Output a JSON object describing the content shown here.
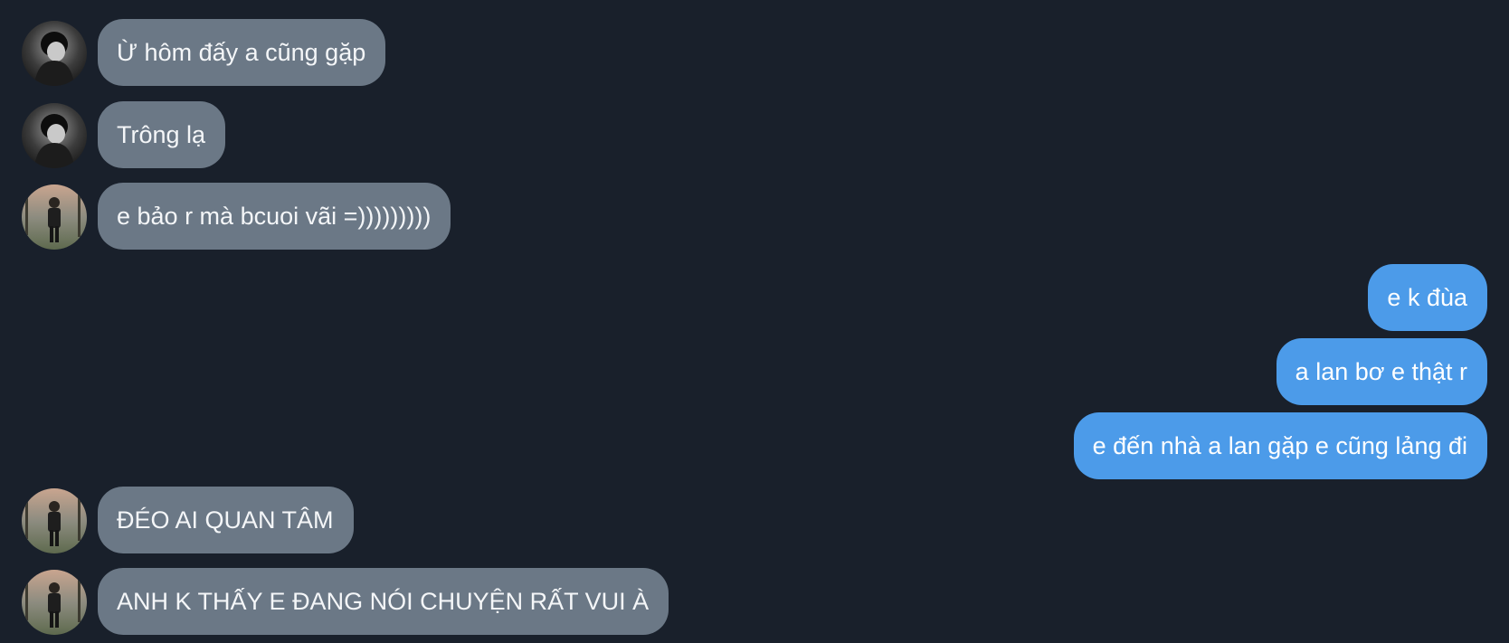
{
  "messages": [
    {
      "direction": "incoming",
      "sender_avatar": "avatar-a",
      "text": "Ừ hôm đấy a cũng gặp"
    },
    {
      "direction": "incoming",
      "sender_avatar": "avatar-a",
      "text": "Trông lạ"
    },
    {
      "direction": "incoming",
      "sender_avatar": "avatar-b",
      "text": "e bảo r mà bcuoi vãi =)))))))))"
    },
    {
      "direction": "outgoing",
      "text": "e k đùa"
    },
    {
      "direction": "outgoing",
      "text": "a lan bơ e thật r"
    },
    {
      "direction": "outgoing",
      "text": "e đến nhà a lan gặp e cũng lảng đi"
    },
    {
      "direction": "incoming",
      "sender_avatar": "avatar-b",
      "text": "ĐÉO AI QUAN TÂM"
    },
    {
      "direction": "incoming",
      "sender_avatar": "avatar-b",
      "text": "ANH K THẤY E ĐANG NÓI CHUYỆN RẤT VUI À"
    }
  ],
  "colors": {
    "background": "#19202b",
    "incoming_bubble": "#6b7886",
    "outgoing_bubble": "#4c9be9",
    "text": "#f4f6f8"
  }
}
